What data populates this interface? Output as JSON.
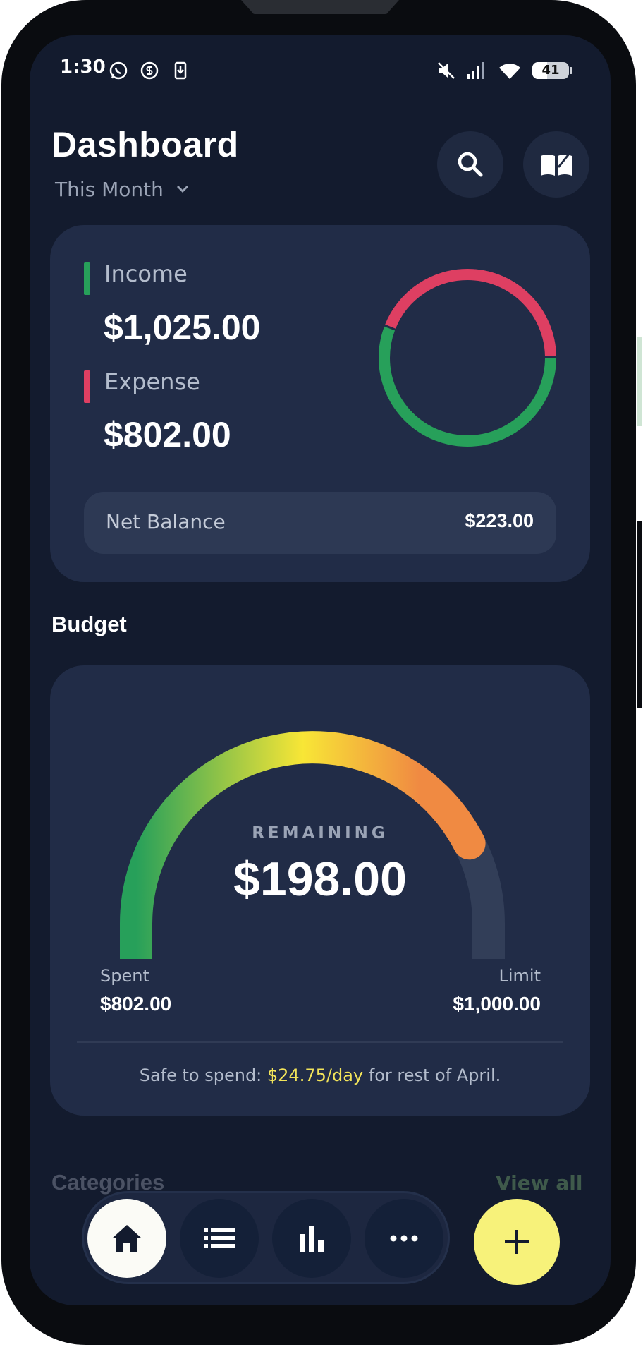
{
  "status_bar": {
    "time": "1:30",
    "battery": "41",
    "icons": [
      "whatsapp-icon",
      "money-icon",
      "download-icon",
      "mute-icon",
      "signal-icon",
      "wifi-icon",
      "battery-icon"
    ]
  },
  "header": {
    "title": "Dashboard",
    "period": "This Month",
    "buttons": [
      "search-icon",
      "book-icon"
    ]
  },
  "summary": {
    "income_label": "Income",
    "income_amount": "$1,025.00",
    "expense_label": "Expense",
    "expense_amount": "$802.00",
    "net_label": "Net Balance",
    "net_amount": "$223.00",
    "donut": {
      "income": 1025,
      "expense": 802
    },
    "colors": {
      "income": "#27a05a",
      "expense": "#de3f62"
    }
  },
  "budget": {
    "section_title": "Budget",
    "remaining_label": "REMAINING",
    "remaining_amount": "$198.00",
    "spent_label": "Spent",
    "spent_amount": "$802.00",
    "limit_label": "Limit",
    "limit_amount": "$1,000.00",
    "spent_fraction": 0.802,
    "safe_prefix": "Safe to spend: ",
    "safe_rate": "$24.75/day",
    "safe_suffix": " for rest of April.",
    "colors": {
      "start": "#27a05a",
      "mid": "#f8e636",
      "end": "#f08a42",
      "track": "#323e58"
    }
  },
  "categories": {
    "title": "Categories",
    "view_all": "View all"
  },
  "nav": {
    "items": [
      "home-icon",
      "list-icon",
      "chart-icon",
      "more-icon"
    ],
    "active": "home",
    "fab": "plus-icon"
  }
}
